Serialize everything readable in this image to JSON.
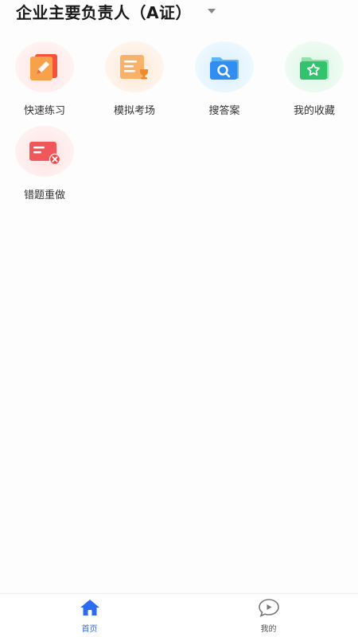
{
  "header": {
    "title": "企业主要负责人（A证）",
    "dropdown_icon": "caret-down-icon"
  },
  "menu": {
    "items": [
      {
        "label": "快速练习",
        "icon": "pencil-card-icon",
        "accent": "#f06a3c"
      },
      {
        "label": "模拟考场",
        "icon": "certificate-trophy-icon",
        "accent": "#f8a14b"
      },
      {
        "label": "搜答案",
        "icon": "folder-search-icon",
        "accent": "#3a9ff0"
      },
      {
        "label": "我的收藏",
        "icon": "folder-star-icon",
        "accent": "#36c777"
      },
      {
        "label": "错题重做",
        "icon": "card-error-icon",
        "accent": "#ef5b5b"
      }
    ]
  },
  "tabbar": {
    "tabs": [
      {
        "label": "首页",
        "icon": "home-icon",
        "active": true
      },
      {
        "label": "我的",
        "icon": "chat-play-icon",
        "active": false
      }
    ],
    "active_color": "#2f6bf1",
    "inactive_color": "#555555"
  }
}
